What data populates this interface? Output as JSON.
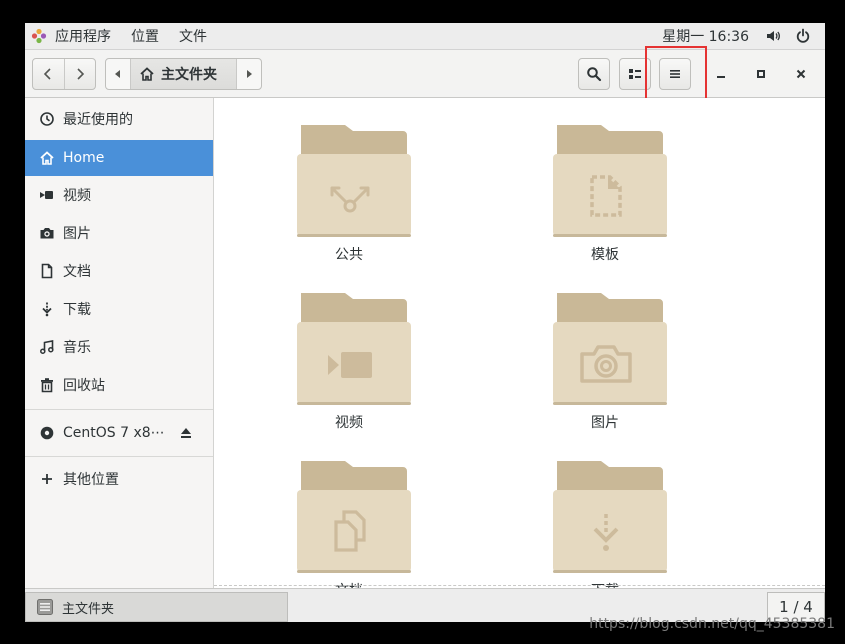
{
  "topbar": {
    "menus": [
      "应用程序",
      "位置",
      "文件"
    ],
    "clock": "星期一 16:36",
    "icons": [
      "apps-logo-icon",
      "volume-icon",
      "power-icon"
    ]
  },
  "headerbar": {
    "breadcrumb": "主文件夹",
    "icons": [
      "back-icon",
      "forward-icon",
      "home-icon",
      "search-icon",
      "view-toggle-icon",
      "hamburger-menu-icon",
      "minimize-icon",
      "maximize-icon",
      "close-icon"
    ]
  },
  "sidebar": {
    "items": [
      {
        "label": "最近使用的",
        "icon": "recent-icon"
      },
      {
        "label": "Home",
        "icon": "home-icon",
        "active": true
      },
      {
        "label": "视频",
        "icon": "video-icon"
      },
      {
        "label": "图片",
        "icon": "camera-icon"
      },
      {
        "label": "文档",
        "icon": "document-icon"
      },
      {
        "label": "下载",
        "icon": "download-icon"
      },
      {
        "label": "音乐",
        "icon": "music-icon"
      },
      {
        "label": "回收站",
        "icon": "trash-icon"
      },
      {
        "label": "CentOS 7 x8⋯",
        "icon": "disc-icon"
      },
      {
        "label": "其他位置",
        "icon": "plus-icon"
      }
    ]
  },
  "folders": [
    {
      "name": "公共",
      "icon": "share-icon"
    },
    {
      "name": "模板",
      "icon": "template-icon"
    },
    {
      "name": "视频",
      "icon": "video-icon"
    },
    {
      "name": "图片",
      "icon": "camera-icon"
    },
    {
      "name": "文档",
      "icon": "document-icon"
    },
    {
      "name": "下载",
      "icon": "download-icon"
    }
  ],
  "statusbar": {
    "tab_label": "主文件夹",
    "page": "1 / 4"
  },
  "watermark": "https://blog.csdn.net/qq_45385381",
  "colors": {
    "accent": "#4a90d9",
    "folder_front": "#e5d9c0",
    "folder_back": "#c9b897",
    "highlight": "#e53333"
  }
}
